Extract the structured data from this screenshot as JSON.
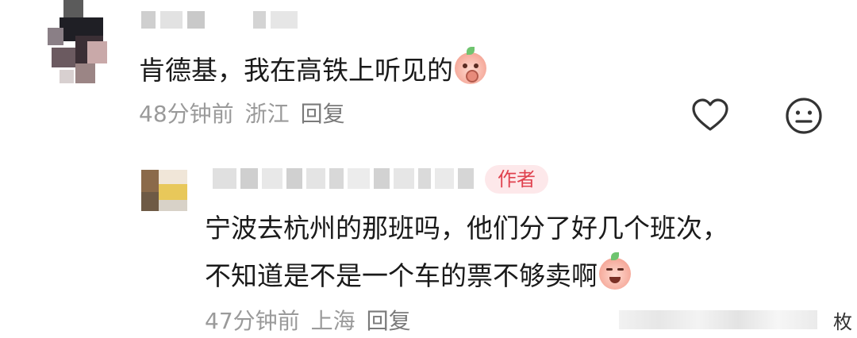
{
  "comment": {
    "text": "肯德基，我在高铁上听见的",
    "emoji": "covering-mouth-peach-emoji",
    "time": "48分钟前",
    "location": "浙江",
    "reply_label": "回复"
  },
  "reply": {
    "badge": "作者",
    "line1": "宁波去杭州的那班吗，他们分了好几个班次，",
    "line2": "不知道是不是一个车的票不够卖啊",
    "emoji": "crying-laughing-peach-emoji",
    "time": "47分钟前",
    "location": "上海",
    "reply_label": "回复"
  },
  "footer": {
    "count_suffix": "枚"
  },
  "colors": {
    "badge_bg": "#fde8ea",
    "badge_text": "#e0424f",
    "meta_text": "#9a9a9a"
  }
}
